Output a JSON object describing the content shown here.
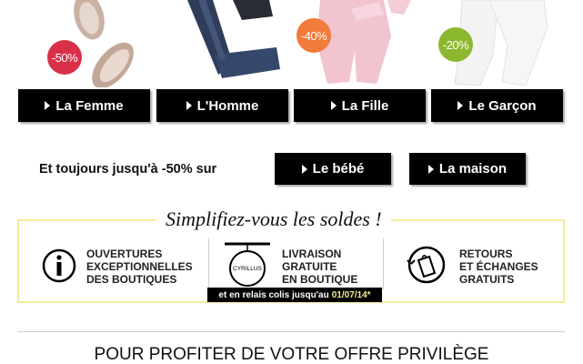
{
  "products": [
    {
      "badge": "-50%",
      "badge_color": "#d9304a",
      "icon": "ballerina-flats-image"
    },
    {
      "badge": "",
      "icon": "jeans-image"
    },
    {
      "badge": "-40%",
      "badge_color": "#f27a3a",
      "icon": "pink-trousers-image"
    },
    {
      "badge": "-20%",
      "badge_color": "#8cb830",
      "icon": "white-trousers-image"
    }
  ],
  "categories": [
    {
      "label": "La Femme"
    },
    {
      "label": "L'Homme"
    },
    {
      "label": "La Fille"
    },
    {
      "label": "Le Garçon"
    }
  ],
  "promo": {
    "text": "Et toujours jusqu'à -50% sur",
    "buttons": [
      {
        "label": "Le bébé"
      },
      {
        "label": "La maison"
      }
    ]
  },
  "features": {
    "title": "Simplifiez-vous les soldes !",
    "items": [
      {
        "icon": "info-icon",
        "line1": "OUVERTURES",
        "line2": "EXCEPTIONNELLES",
        "line3": "DES BOUTIQUES"
      },
      {
        "icon": "cyrillus-shop-sign-icon",
        "sign_text": "CYRILLUS",
        "line1": "LIVRAISON",
        "line2": "GRATUITE",
        "line3": "EN BOUTIQUE"
      },
      {
        "icon": "return-bag-icon",
        "line1": "RETOURS",
        "line2": "ET ÉCHANGES",
        "line3": "GRATUITS"
      }
    ],
    "relay_text": "et en relais colis jusqu'au",
    "relay_date": "01/07/14*"
  },
  "offer_heading": "POUR PROFITER DE VOTRE OFFRE PRIVILÈGE",
  "colors": {
    "accent_yellow": "#f3ec98",
    "button_black": "#000000"
  }
}
